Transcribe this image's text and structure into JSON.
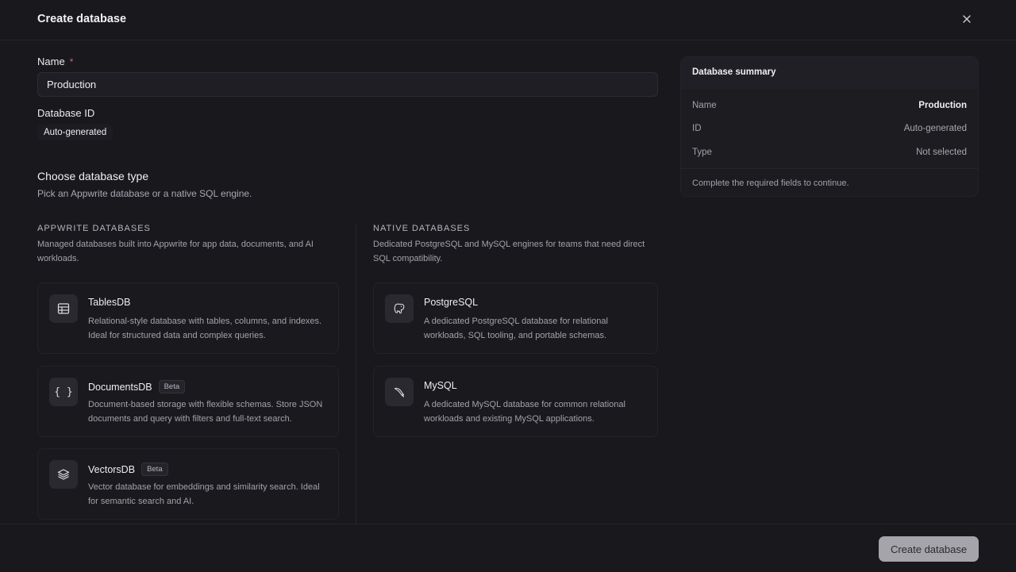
{
  "dialog": {
    "title": "Create database",
    "close_icon": "close-icon"
  },
  "form": {
    "name_label": "Name",
    "required_mark": "*",
    "name_value": "Production",
    "id_label": "Database ID",
    "id_value": "Auto-generated"
  },
  "type_section": {
    "title": "Choose database type",
    "subtitle": "Pick an Appwrite database or a native SQL engine."
  },
  "appwrite": {
    "heading": "Appwrite databases",
    "description_line1": "Managed databases built into Appwrite for app data, documents, and AI",
    "description_line2": "workloads.",
    "cards": [
      {
        "icon": "table-icon",
        "title": "TablesDB",
        "badge": "",
        "desc_line1": "Relational-style database with tables, columns, and indexes.",
        "desc_line2": "Ideal for structured data and complex queries."
      },
      {
        "icon": "braces-icon",
        "title": "DocumentsDB",
        "badge": "Beta",
        "desc_line1": "Document-based storage with flexible schemas. Store JSON",
        "desc_line2": "documents and query with filters and full-text search."
      },
      {
        "icon": "layers-icon",
        "title": "VectorsDB",
        "badge": "Beta",
        "desc_line1": "Vector database for embeddings and similarity search. Ideal",
        "desc_line2": "for semantic search and AI."
      }
    ]
  },
  "native": {
    "heading": "Native databases",
    "description_line1": "Dedicated PostgreSQL and MySQL engines for teams that need direct",
    "description_line2": "SQL compatibility.",
    "cards": [
      {
        "icon": "postgres-elephant-icon",
        "title": "PostgreSQL",
        "desc_line1": "A dedicated PostgreSQL database for relational",
        "desc_line2": "workloads, SQL tooling, and portable schemas."
      },
      {
        "icon": "mysql-dolphin-icon",
        "title": "MySQL",
        "desc_line1": "A dedicated MySQL database for common relational",
        "desc_line2": "workloads and existing MySQL applications."
      }
    ]
  },
  "summary": {
    "title": "Database summary",
    "rows": [
      {
        "key": "Name",
        "value": "Production"
      },
      {
        "key": "ID",
        "value": "Auto-generated"
      },
      {
        "key": "Type",
        "value": "Not selected"
      }
    ],
    "footer_text": "Complete the required fields to continue."
  },
  "footer": {
    "create_label": "Create database"
  }
}
